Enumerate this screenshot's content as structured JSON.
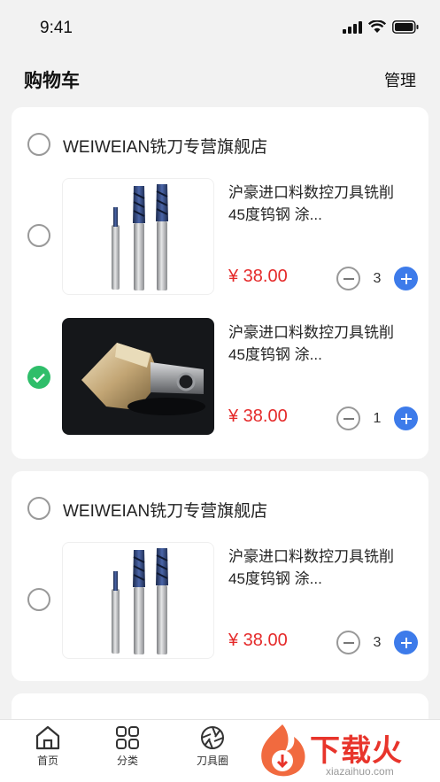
{
  "status": {
    "time": "9:41"
  },
  "header": {
    "title": "购物车",
    "manage_label": "管理"
  },
  "stores": [
    {
      "name": "WEIWEIAN铣刀专营旗舰店",
      "selected": false,
      "items": [
        {
          "title": "沪豪进口料数控刀具铣削45度钨钢 涂...",
          "price": "¥ 38.00",
          "quantity": "3",
          "selected": false,
          "image": "blue-coated-end-mills"
        },
        {
          "title": "沪豪进口料数控刀具铣削45度钨钢 涂...",
          "price": "¥ 38.00",
          "quantity": "1",
          "selected": true,
          "image": "gold-router-bit"
        }
      ]
    },
    {
      "name": "WEIWEIAN铣刀专营旗舰店",
      "selected": false,
      "items": [
        {
          "title": "沪豪进口料数控刀具铣削45度钨钢 涂...",
          "price": "¥ 38.00",
          "quantity": "3",
          "selected": false,
          "image": "blue-coated-end-mills"
        }
      ]
    }
  ],
  "tabbar": {
    "items": [
      {
        "label": "首页",
        "icon": "home-icon"
      },
      {
        "label": "分类",
        "icon": "grid-icon"
      },
      {
        "label": "刀具圈",
        "icon": "aperture-icon"
      }
    ]
  },
  "watermark": {
    "text": "下载火",
    "url": "xiazaihuo.com"
  },
  "colors": {
    "price": "#e52a2a",
    "accent": "#3d7bea",
    "checked": "#2fbe6a"
  }
}
